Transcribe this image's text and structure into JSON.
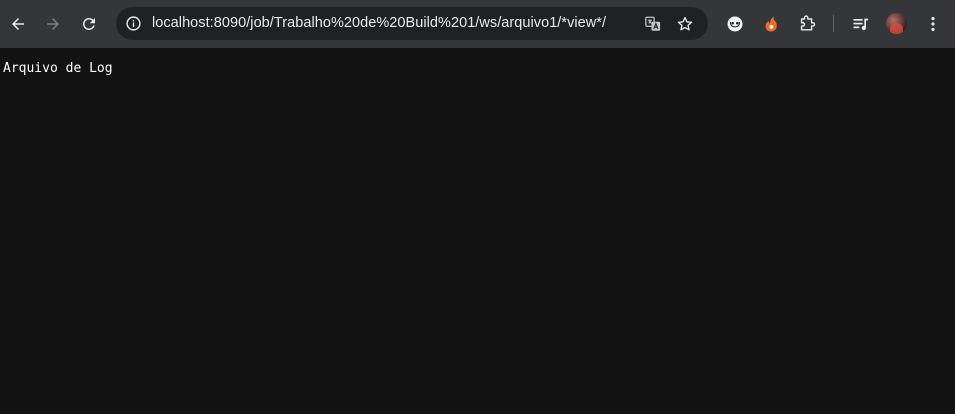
{
  "browser": {
    "address_bar": {
      "url": "localhost:8090/job/Trabalho%20de%20Build%201/ws/arquivo1/*view*/"
    },
    "toolbar_icons": {
      "back": "arrow-left-icon",
      "forward": "arrow-right-icon",
      "reload": "reload-icon",
      "site_info": "info-icon",
      "translate": "translate-icon",
      "bookmark": "star-icon",
      "extensions": [
        "dark-reader-icon",
        "flame-extension-icon",
        "puzzle-icon",
        "media-queue-icon"
      ],
      "menu": "vertical-dots-icon"
    },
    "colors": {
      "toolbar_bg": "#35363a",
      "omnibox_bg": "#202124",
      "page_bg": "#121212",
      "accent_orange": "#f26b21"
    }
  },
  "page": {
    "text": "Arquivo de Log"
  }
}
